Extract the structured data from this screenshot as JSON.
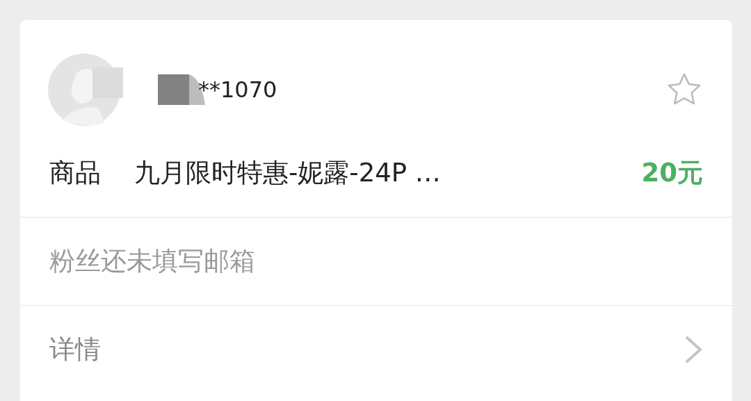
{
  "fan": {
    "name": "**1070",
    "starred": false
  },
  "product": {
    "label": "商品",
    "title": "九月限时特惠-妮露-24P …",
    "price": "20元"
  },
  "email_notice": "粉丝还未填写邮箱",
  "details": {
    "label": "详情"
  }
}
